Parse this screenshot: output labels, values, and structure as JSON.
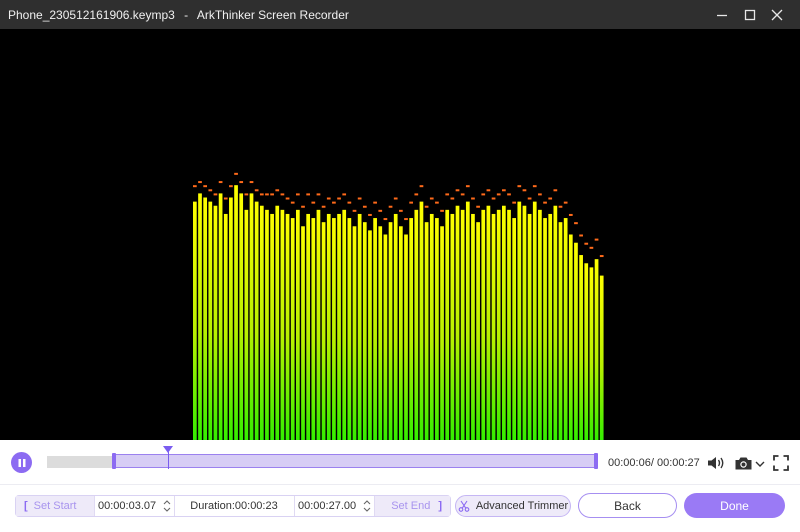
{
  "window": {
    "filename": "Phone_230512161906.keymp3",
    "separator": "-",
    "app_name": "ArkThinker Screen Recorder"
  },
  "colors": {
    "accent": "#8c6bf2",
    "bar_top": "#ffff00",
    "bar_bottom": "#33ee00",
    "peak": "#ff6a1a"
  },
  "player": {
    "current_time": "00:00:06",
    "total_time": "00:00:27",
    "time_sep": "/ ",
    "progress": 0.22
  },
  "visualizer": {
    "levels": [
      0.58,
      0.6,
      0.59,
      0.58,
      0.57,
      0.6,
      0.55,
      0.59,
      0.62,
      0.6,
      0.56,
      0.6,
      0.58,
      0.57,
      0.56,
      0.55,
      0.57,
      0.56,
      0.55,
      0.54,
      0.56,
      0.52,
      0.55,
      0.54,
      0.56,
      0.53,
      0.55,
      0.54,
      0.55,
      0.56,
      0.54,
      0.52,
      0.55,
      0.53,
      0.51,
      0.54,
      0.52,
      0.5,
      0.53,
      0.55,
      0.52,
      0.5,
      0.54,
      0.56,
      0.58,
      0.53,
      0.55,
      0.54,
      0.52,
      0.56,
      0.55,
      0.57,
      0.56,
      0.58,
      0.55,
      0.53,
      0.56,
      0.57,
      0.55,
      0.56,
      0.57,
      0.56,
      0.54,
      0.58,
      0.57,
      0.55,
      0.58,
      0.56,
      0.54,
      0.55,
      0.57,
      0.53,
      0.54,
      0.5,
      0.48,
      0.45,
      0.43,
      0.42,
      0.44,
      0.4
    ],
    "peaks": [
      0.62,
      0.63,
      0.62,
      0.61,
      0.6,
      0.63,
      0.59,
      0.62,
      0.65,
      0.63,
      0.6,
      0.63,
      0.61,
      0.6,
      0.6,
      0.6,
      0.61,
      0.6,
      0.59,
      0.58,
      0.6,
      0.57,
      0.6,
      0.58,
      0.6,
      0.57,
      0.59,
      0.58,
      0.59,
      0.6,
      0.58,
      0.56,
      0.59,
      0.57,
      0.55,
      0.58,
      0.56,
      0.54,
      0.57,
      0.59,
      0.56,
      0.54,
      0.58,
      0.6,
      0.62,
      0.57,
      0.59,
      0.58,
      0.56,
      0.6,
      0.59,
      0.61,
      0.6,
      0.62,
      0.59,
      0.57,
      0.6,
      0.61,
      0.59,
      0.6,
      0.61,
      0.6,
      0.58,
      0.62,
      0.61,
      0.59,
      0.62,
      0.6,
      0.58,
      0.59,
      0.61,
      0.57,
      0.58,
      0.55,
      0.53,
      0.5,
      0.48,
      0.47,
      0.49,
      0.45
    ]
  },
  "trim": {
    "selection_start": 0.12,
    "selection_end": 1.0,
    "set_start_label": "Set Start",
    "start_value": "00:00:03.07",
    "duration_label": "Duration:00:00:23",
    "end_value": "00:00:27.00",
    "set_end_label": "Set End",
    "bracket_open": "[",
    "bracket_close": "]"
  },
  "buttons": {
    "advanced_trimmer": "Advanced Trimmer",
    "back": "Back",
    "done": "Done"
  },
  "icons": {
    "minimize": "minimize-icon",
    "maximize": "maximize-icon",
    "close": "close-icon",
    "pause": "pause-icon",
    "volume": "volume-icon",
    "camera": "camera-icon",
    "fullscreen": "fullscreen-icon",
    "trimmer": "trimmer-icon"
  }
}
